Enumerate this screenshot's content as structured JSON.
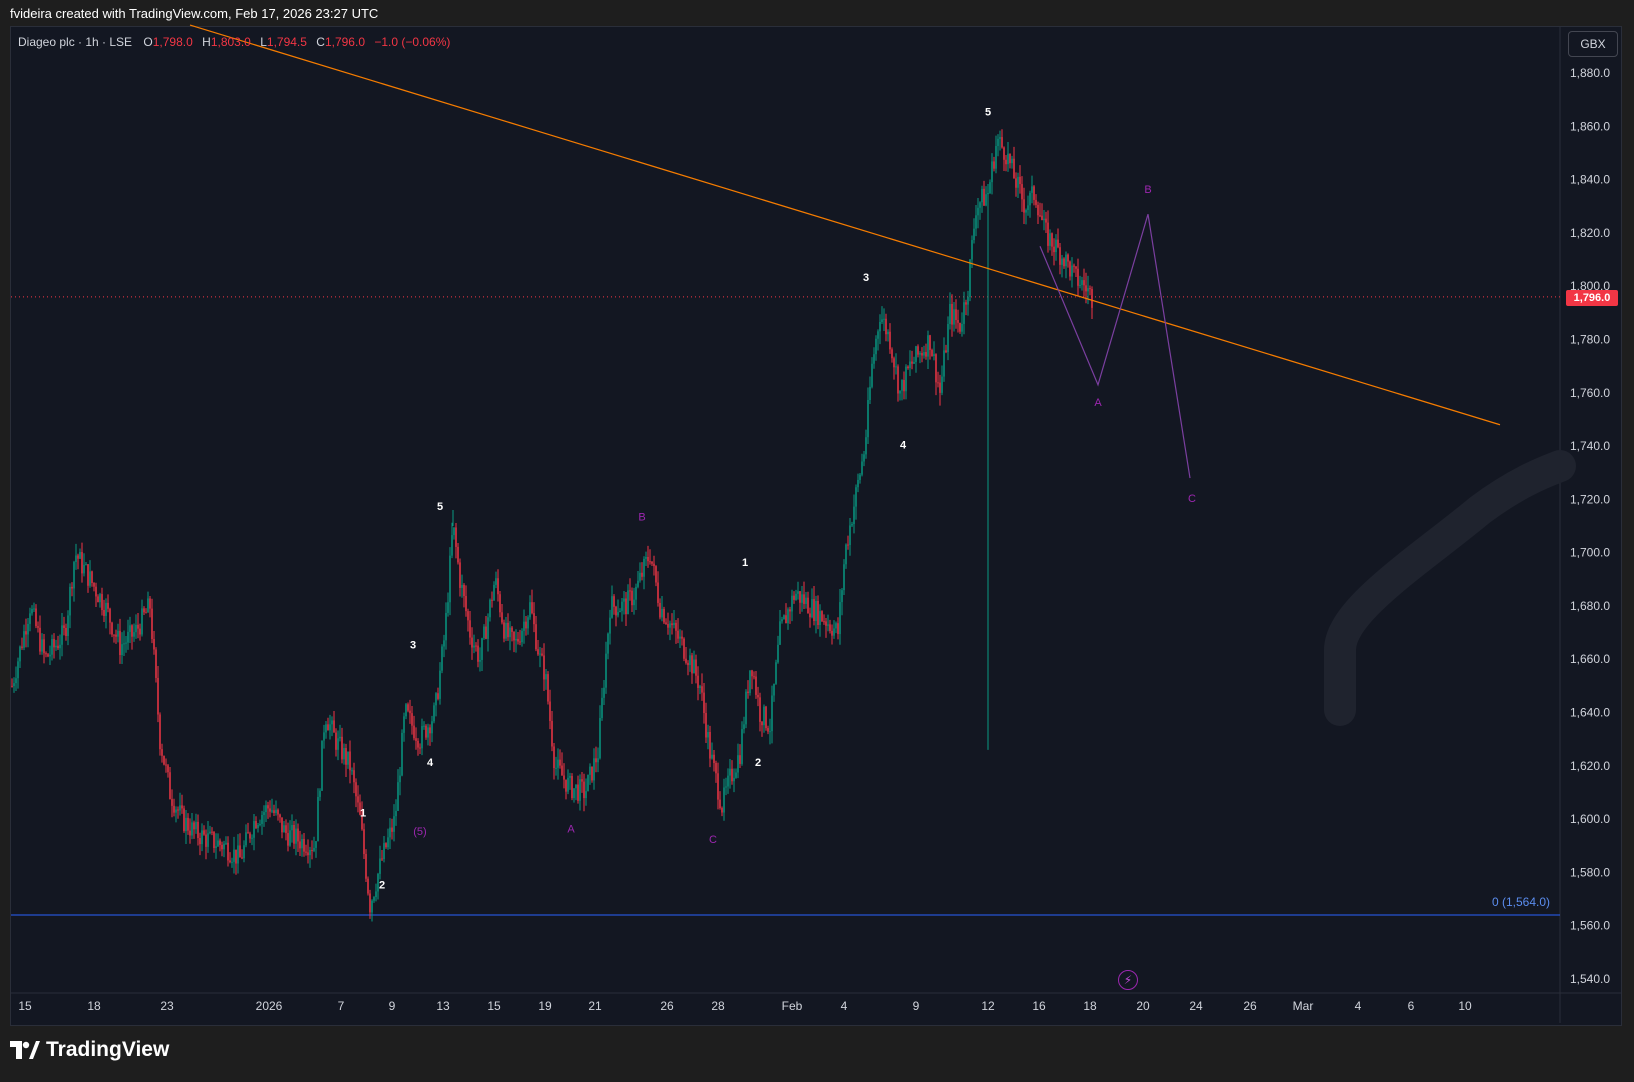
{
  "header": {
    "created_by": "fvideira created with TradingView.com, Feb 17, 2026 23:27 UTC"
  },
  "symbol": {
    "name": "Diageo plc · 1h · LSE",
    "open_label": "O",
    "open": "1,798.0",
    "high_label": "H",
    "high": "1,803.0",
    "low_label": "L",
    "low": "1,794.5",
    "close_label": "C",
    "close": "1,796.0",
    "change": "−1.0 (−0.06%)"
  },
  "currency": "GBX",
  "last_price_badge": "1,796.0",
  "fib_label": "0 (1,564.0)",
  "brand": "TradingView",
  "colors": {
    "up": "#089981",
    "down": "#f23645",
    "trendline": "#f57c00",
    "fib": "#2962ff",
    "wave_abc": "#9c27b0",
    "wave_impulse": "#ffffff",
    "background": "#131722"
  },
  "chart_data": {
    "type": "candlestick",
    "interval": "1h",
    "y_axis": {
      "ylim": [
        1530,
        1895
      ],
      "ticks": [
        "1,880.0",
        "1,860.0",
        "1,840.0",
        "1,820.0",
        "1,800.0",
        "1,780.0",
        "1,760.0",
        "1,740.0",
        "1,720.0",
        "1,700.0",
        "1,680.0",
        "1,660.0",
        "1,640.0",
        "1,620.0",
        "1,600.0",
        "1,580.0",
        "1,560.0",
        "1,540.0"
      ],
      "tick_values": [
        1880,
        1860,
        1840,
        1820,
        1800,
        1780,
        1760,
        1740,
        1720,
        1700,
        1680,
        1660,
        1640,
        1620,
        1600,
        1580,
        1560,
        1540
      ]
    },
    "x_axis": {
      "ticks": [
        {
          "label": "15",
          "x": 15
        },
        {
          "label": "18",
          "x": 84
        },
        {
          "label": "23",
          "x": 157
        },
        {
          "label": "2026",
          "x": 259
        },
        {
          "label": "7",
          "x": 331
        },
        {
          "label": "9",
          "x": 382
        },
        {
          "label": "13",
          "x": 433
        },
        {
          "label": "15",
          "x": 484
        },
        {
          "label": "19",
          "x": 535
        },
        {
          "label": "21",
          "x": 585
        },
        {
          "label": "26",
          "x": 657
        },
        {
          "label": "28",
          "x": 708
        },
        {
          "label": "Feb",
          "x": 782
        },
        {
          "label": "4",
          "x": 834
        },
        {
          "label": "9",
          "x": 906
        },
        {
          "label": "12",
          "x": 978
        },
        {
          "label": "16",
          "x": 1029
        },
        {
          "label": "18",
          "x": 1080
        },
        {
          "label": "20",
          "x": 1133
        },
        {
          "label": "24",
          "x": 1186
        },
        {
          "label": "26",
          "x": 1240
        },
        {
          "label": "Mar",
          "x": 1293
        },
        {
          "label": "4",
          "x": 1348
        },
        {
          "label": "6",
          "x": 1401
        },
        {
          "label": "10",
          "x": 1455
        }
      ]
    },
    "close_anchors": [
      [
        2,
        1650
      ],
      [
        20,
        1680
      ],
      [
        35,
        1660
      ],
      [
        55,
        1670
      ],
      [
        65,
        1700
      ],
      [
        80,
        1690
      ],
      [
        95,
        1680
      ],
      [
        110,
        1665
      ],
      [
        125,
        1670
      ],
      [
        140,
        1680
      ],
      [
        150,
        1630
      ],
      [
        160,
        1610
      ],
      [
        172,
        1600
      ],
      [
        185,
        1595
      ],
      [
        200,
        1592
      ],
      [
        215,
        1590
      ],
      [
        230,
        1585
      ],
      [
        245,
        1600
      ],
      [
        260,
        1605
      ],
      [
        275,
        1595
      ],
      [
        290,
        1592
      ],
      [
        305,
        1590
      ],
      [
        315,
        1640
      ],
      [
        325,
        1630
      ],
      [
        340,
        1620
      ],
      [
        350,
        1600
      ],
      [
        360,
        1568
      ],
      [
        372,
        1585
      ],
      [
        385,
        1600
      ],
      [
        395,
        1640
      ],
      [
        410,
        1630
      ],
      [
        425,
        1640
      ],
      [
        435,
        1670
      ],
      [
        443,
        1710
      ],
      [
        450,
        1690
      ],
      [
        460,
        1670
      ],
      [
        470,
        1660
      ],
      [
        485,
        1690
      ],
      [
        495,
        1670
      ],
      [
        505,
        1665
      ],
      [
        520,
        1680
      ],
      [
        530,
        1660
      ],
      [
        535,
        1655
      ],
      [
        545,
        1620
      ],
      [
        560,
        1612
      ],
      [
        575,
        1610
      ],
      [
        588,
        1625
      ],
      [
        600,
        1680
      ],
      [
        615,
        1680
      ],
      [
        625,
        1685
      ],
      [
        640,
        1700
      ],
      [
        650,
        1680
      ],
      [
        665,
        1670
      ],
      [
        680,
        1660
      ],
      [
        690,
        1650
      ],
      [
        700,
        1625
      ],
      [
        712,
        1605
      ],
      [
        720,
        1615
      ],
      [
        730,
        1625
      ],
      [
        741,
        1660
      ],
      [
        750,
        1640
      ],
      [
        760,
        1635
      ],
      [
        770,
        1670
      ],
      [
        785,
        1685
      ],
      [
        800,
        1680
      ],
      [
        815,
        1675
      ],
      [
        828,
        1670
      ],
      [
        835,
        1700
      ],
      [
        845,
        1720
      ],
      [
        855,
        1740
      ],
      [
        862,
        1770
      ],
      [
        870,
        1790
      ],
      [
        880,
        1780
      ],
      [
        890,
        1760
      ],
      [
        900,
        1770
      ],
      [
        910,
        1775
      ],
      [
        920,
        1780
      ],
      [
        930,
        1760
      ],
      [
        940,
        1790
      ],
      [
        950,
        1785
      ],
      [
        958,
        1800
      ],
      [
        966,
        1830
      ],
      [
        978,
        1835
      ],
      [
        987,
        1855
      ],
      [
        996,
        1850
      ],
      [
        1005,
        1840
      ],
      [
        1015,
        1830
      ],
      [
        1025,
        1835
      ],
      [
        1035,
        1820
      ],
      [
        1045,
        1815
      ],
      [
        1055,
        1810
      ],
      [
        1065,
        1803
      ],
      [
        1075,
        1800
      ],
      [
        1082,
        1796
      ]
    ],
    "events": [
      {
        "x": 978,
        "low": 1626,
        "note": "wick"
      },
      {
        "x": 360,
        "low": 1564,
        "note": "wick"
      },
      {
        "x": 443,
        "high": 1716,
        "note": "wick"
      }
    ],
    "last_price": 1796.0,
    "trendline": {
      "p1": [
        180,
        1898
      ],
      "p2": [
        1490,
        1748
      ]
    },
    "fib_level": {
      "price": 1564.0,
      "label": "0 (1,564.0)"
    },
    "projection_abc": {
      "points": [
        [
          1030,
          1815
        ],
        [
          1088,
          1763
        ],
        [
          1138,
          1827
        ],
        [
          1180,
          1728
        ]
      ]
    },
    "wave_labels": [
      {
        "text": "5",
        "x": 978,
        "price": 1864,
        "color": "white"
      },
      {
        "text": "3",
        "x": 856,
        "price": 1802,
        "color": "white"
      },
      {
        "text": "4",
        "x": 893,
        "price": 1739,
        "color": "white"
      },
      {
        "text": "5",
        "x": 430,
        "price": 1716,
        "color": "white"
      },
      {
        "text": "3",
        "x": 403,
        "price": 1664,
        "color": "white"
      },
      {
        "text": "4",
        "x": 420,
        "price": 1620,
        "color": "white"
      },
      {
        "text": "1",
        "x": 353,
        "price": 1601,
        "color": "white"
      },
      {
        "text": "2",
        "x": 372,
        "price": 1574,
        "color": "white"
      },
      {
        "text": "(5)",
        "x": 410,
        "price": 1594,
        "color": "#9c27b0"
      },
      {
        "text": "B",
        "x": 632,
        "price": 1712,
        "color": "#9c27b0"
      },
      {
        "text": "A",
        "x": 561,
        "price": 1595,
        "color": "#9c27b0"
      },
      {
        "text": "C",
        "x": 703,
        "price": 1591,
        "color": "#9c27b0"
      },
      {
        "text": "1",
        "x": 735,
        "price": 1695,
        "color": "white"
      },
      {
        "text": "2",
        "x": 748,
        "price": 1620,
        "color": "white"
      },
      {
        "text": "B",
        "x": 1138,
        "price": 1835,
        "color": "#9c27b0"
      },
      {
        "text": "A",
        "x": 1088,
        "price": 1755,
        "color": "#9c27b0"
      },
      {
        "text": "C",
        "x": 1182,
        "price": 1719,
        "color": "#9c27b0"
      }
    ]
  }
}
